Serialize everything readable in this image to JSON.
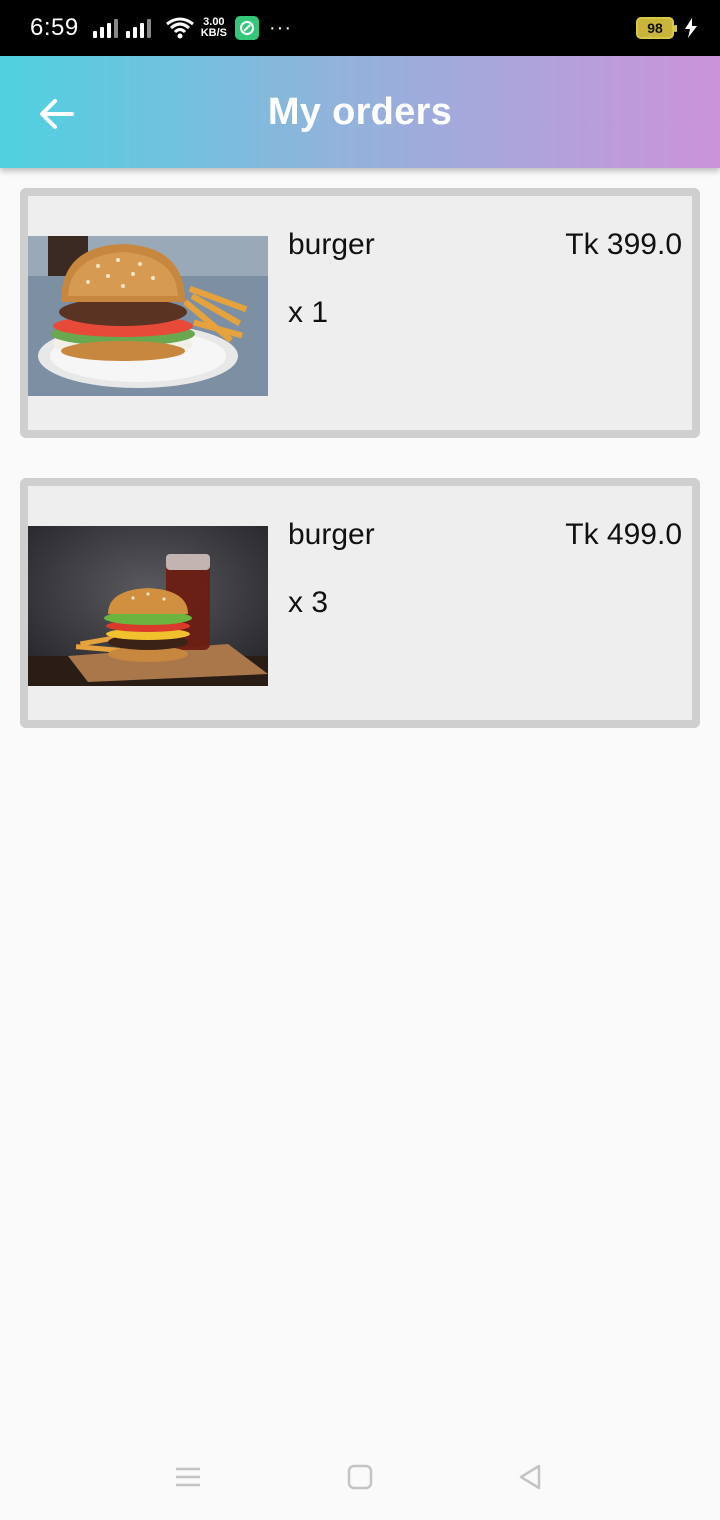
{
  "status_bar": {
    "time": "6:59",
    "net_speed_value": "3.00",
    "net_speed_unit": "KB/S",
    "battery_level": "98",
    "overflow": "···"
  },
  "app_bar": {
    "title": "My orders",
    "back_icon": "arrow-back-icon"
  },
  "orders": [
    {
      "name": "burger",
      "price": "Tk 399.0",
      "quantity": "x 1",
      "image": "burger-with-fries-photo"
    },
    {
      "name": "burger",
      "price": "Tk 499.0",
      "quantity": "x 3",
      "image": "burger-with-cola-photo"
    }
  ],
  "nav_bar": {
    "icons": [
      "menu-icon",
      "home-icon",
      "back-triangle-icon"
    ]
  },
  "colors": {
    "app_bar_gradient_start": "#4fd1e0",
    "app_bar_gradient_end": "#cc93da",
    "card_border": "#cfcfcf",
    "card_background": "#eeeeee"
  }
}
